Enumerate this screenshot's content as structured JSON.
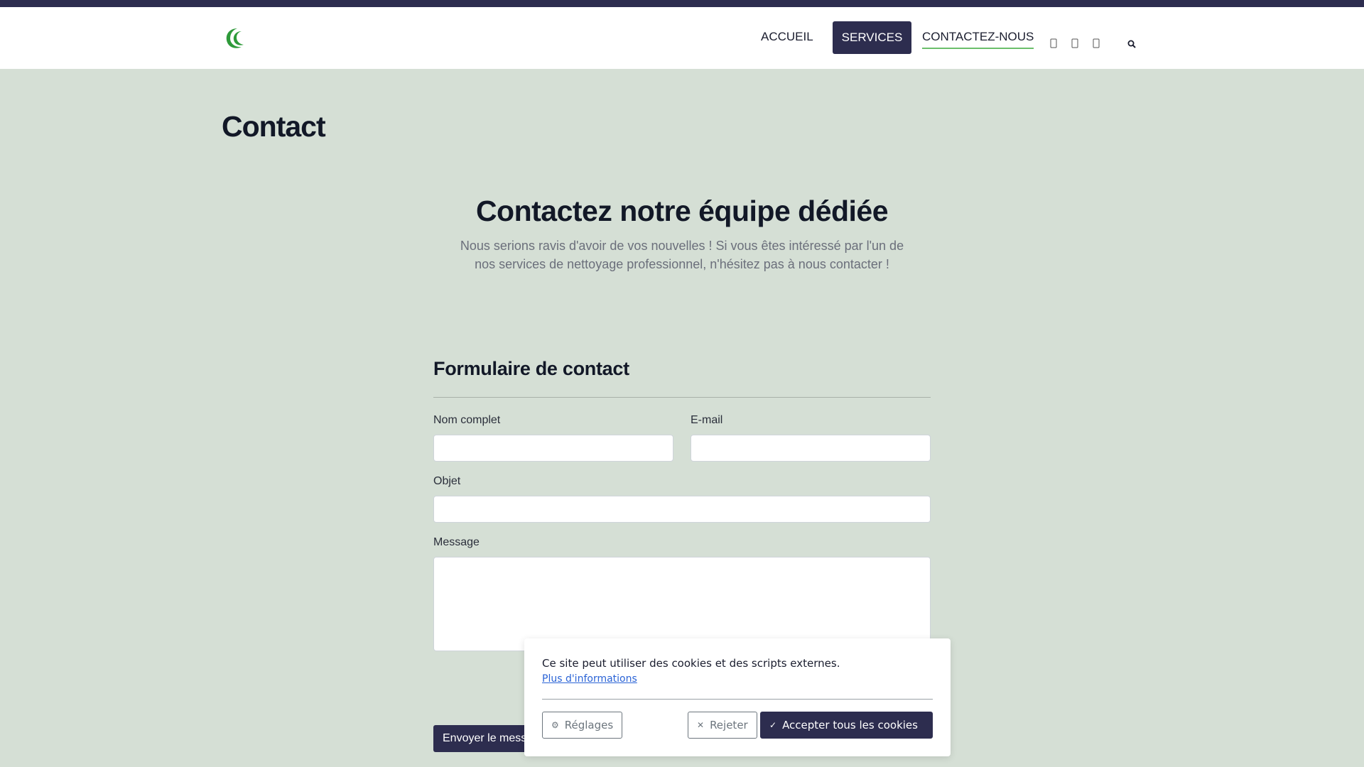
{
  "nav": {
    "home": "ACCUEIL",
    "services": "SERVICES",
    "contact": "CONTACTEZ-NOUS",
    "social_icons": [
      "facebook-icon",
      "instagram-icon",
      "linkedin-icon"
    ],
    "search_icon": "search-icon"
  },
  "page": {
    "title": "Contact"
  },
  "section": {
    "title": "Contactez notre équipe dédiée",
    "description": "Nous serions ravis d'avoir de vos nouvelles ! Si vous êtes intéressé par l'un de nos services de nettoyage professionnel, n'hésitez pas à nous contacter !"
  },
  "form": {
    "title": "Formulaire de contact",
    "name_label": "Nom complet",
    "name_value": "",
    "email_label": "E-mail",
    "email_value": "",
    "subject_label": "Objet",
    "subject_value": "",
    "message_label": "Message",
    "message_value": "",
    "submit_label": "Envoyer le message"
  },
  "cookie": {
    "text": "Ce site peut utiliser des cookies et des scripts externes.",
    "more_info": "Plus d'informations",
    "settings_label": "Réglages",
    "reject_label": "Rejeter",
    "accept_label": "Accepter tous les cookies"
  },
  "colors": {
    "primary": "#2d2d4f",
    "background": "#d5dfd5",
    "accent_green": "#2e9a3a",
    "underline": "#6bbf6b"
  }
}
